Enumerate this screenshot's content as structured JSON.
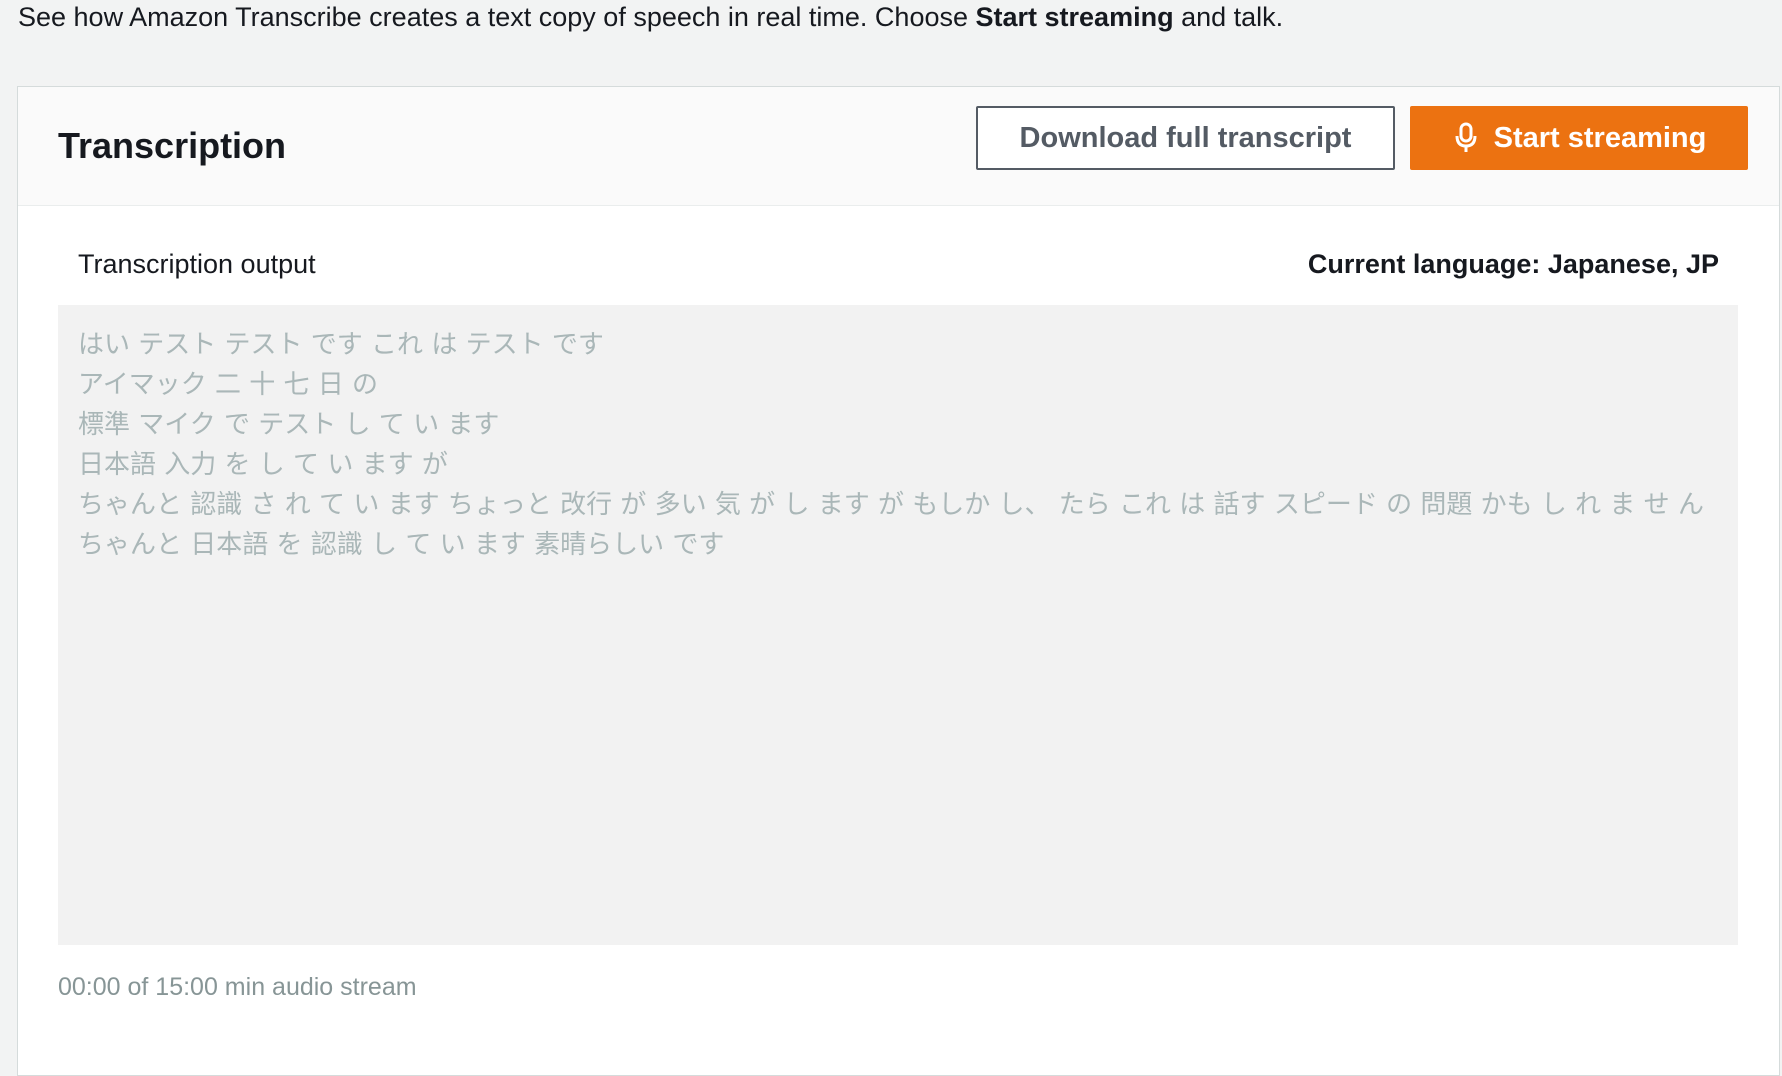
{
  "intro": {
    "prefix": "See how Amazon Transcribe creates a text copy of speech in real time. Choose ",
    "bold": "Start streaming",
    "suffix": " and talk."
  },
  "panel": {
    "title": "Transcription",
    "download_label": "Download full transcript",
    "start_label": "Start streaming",
    "start_icon": "microphone-icon",
    "accent_color": "#ec7211"
  },
  "output": {
    "label": "Transcription output",
    "current_language": "Current language: Japanese, JP",
    "lines": [
      "はい テスト テスト です これ は テスト です",
      "アイマック 二 十 七 日 の",
      "標準 マイク で テスト し て い ます",
      "日本語 入力 を し て い ます が",
      "ちゃんと 認識 さ れ て い ます ちょっと 改行 が 多い 気 が し ます が もしか し、 たら これ は 話す スピード の 問題 かも し れ ま せ ん ちゃんと 日本語 を 認識 し て い ます 素晴らしい です"
    ],
    "status": "00:00 of 15:00 min audio stream"
  }
}
